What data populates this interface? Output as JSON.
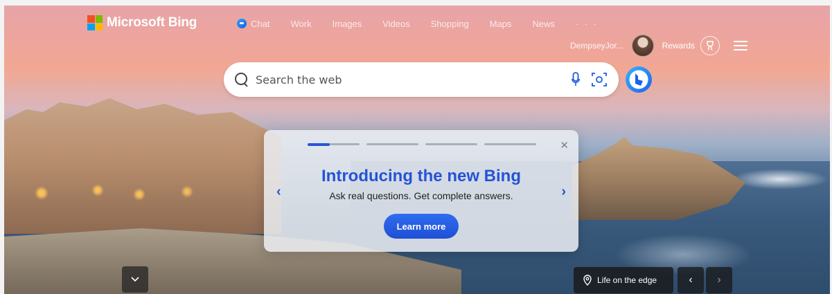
{
  "brand": {
    "name": "Microsoft Bing"
  },
  "nav": {
    "items": [
      {
        "label": "Chat",
        "icon": "chat-icon"
      },
      {
        "label": "Work"
      },
      {
        "label": "Images"
      },
      {
        "label": "Videos"
      },
      {
        "label": "Shopping"
      },
      {
        "label": "Maps"
      },
      {
        "label": "News"
      }
    ],
    "more": "· · ·"
  },
  "user": {
    "name": "DempseyJor...",
    "rewards_label": "Rewards"
  },
  "search": {
    "placeholder": "Search the web"
  },
  "intro_card": {
    "title": "Introducing the new Bing",
    "subtitle": "Ask real questions. Get complete answers.",
    "button_label": "Learn more",
    "close": "✕",
    "prev": "‹",
    "next": "›",
    "active_step": 1,
    "step_count": 4
  },
  "image_info": {
    "location_label": "Life on the edge",
    "prev": "‹",
    "next": "›"
  },
  "colors": {
    "accent": "#2553d5",
    "button": "#1f4fd5"
  }
}
